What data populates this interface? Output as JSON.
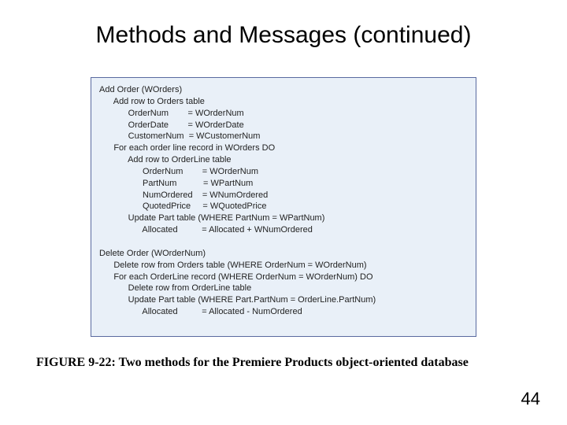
{
  "title": "Methods and Messages (continued)",
  "code_text": "Add Order (WOrders)\n      Add row to Orders table\n            OrderNum        = WOrderNum\n            OrderDate        = WOrderDate\n            CustomerNum  = WCustomerNum\n      For each order line record in WOrders DO\n            Add row to OrderLine table\n                  OrderNum        = WOrderNum\n                  PartNum           = WPartNum\n                  NumOrdered    = WNumOrdered\n                  QuotedPrice     = WQuotedPrice\n            Update Part table (WHERE PartNum = WPartNum)\n                  Allocated          = Allocated + WNumOrdered\n\nDelete Order (WOrderNum)\n      Delete row from Orders table (WHERE OrderNum = WOrderNum)\n      For each OrderLine record (WHERE OrderNum = WOrderNum) DO\n            Delete row from OrderLine table\n            Update Part table (WHERE Part.PartNum = OrderLine.PartNum)\n                  Allocated          = Allocated - NumOrdered",
  "caption": "FIGURE 9-22: Two methods for the Premiere Products object-oriented database",
  "page_number": "44"
}
